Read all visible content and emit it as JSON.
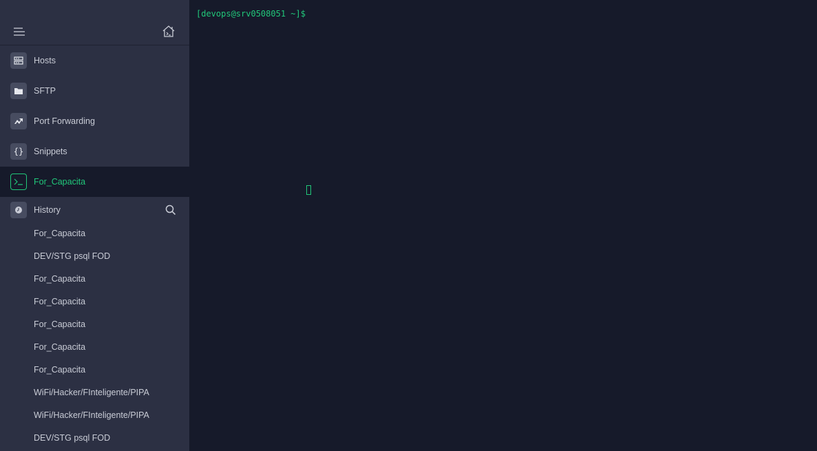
{
  "sidebar": {
    "top": {
      "menu_icon": "hamburger-menu-icon",
      "home_icon": "terminal-home-icon"
    },
    "nav": [
      {
        "label": "Hosts",
        "icon": "hosts-grid-icon"
      },
      {
        "label": "SFTP",
        "icon": "folder-icon"
      },
      {
        "label": "Port Forwarding",
        "icon": "port-forward-icon"
      },
      {
        "label": "Snippets",
        "icon": "braces-icon"
      },
      {
        "label": "For_Capacita",
        "icon": "terminal-prompt-icon",
        "active": true
      }
    ],
    "history": {
      "label": "History",
      "icon": "clock-icon",
      "search_icon": "search-icon",
      "items": [
        "For_Capacita",
        "DEV/STG psql FOD",
        "For_Capacita",
        "For_Capacita",
        "For_Capacita",
        "For_Capacita",
        "For_Capacita",
        "WiFi/Hacker/FInteligente/PIPA",
        "WiFi/Hacker/FInteligente/PIPA",
        "DEV/STG psql FOD"
      ]
    }
  },
  "terminal": {
    "prompt": "[devops@srv0508051 ~]$"
  },
  "colors": {
    "sidebar_bg": "#2c3043",
    "terminal_bg": "#161a2a",
    "accent_green": "#21c87a",
    "text": "#c9ccd6"
  }
}
